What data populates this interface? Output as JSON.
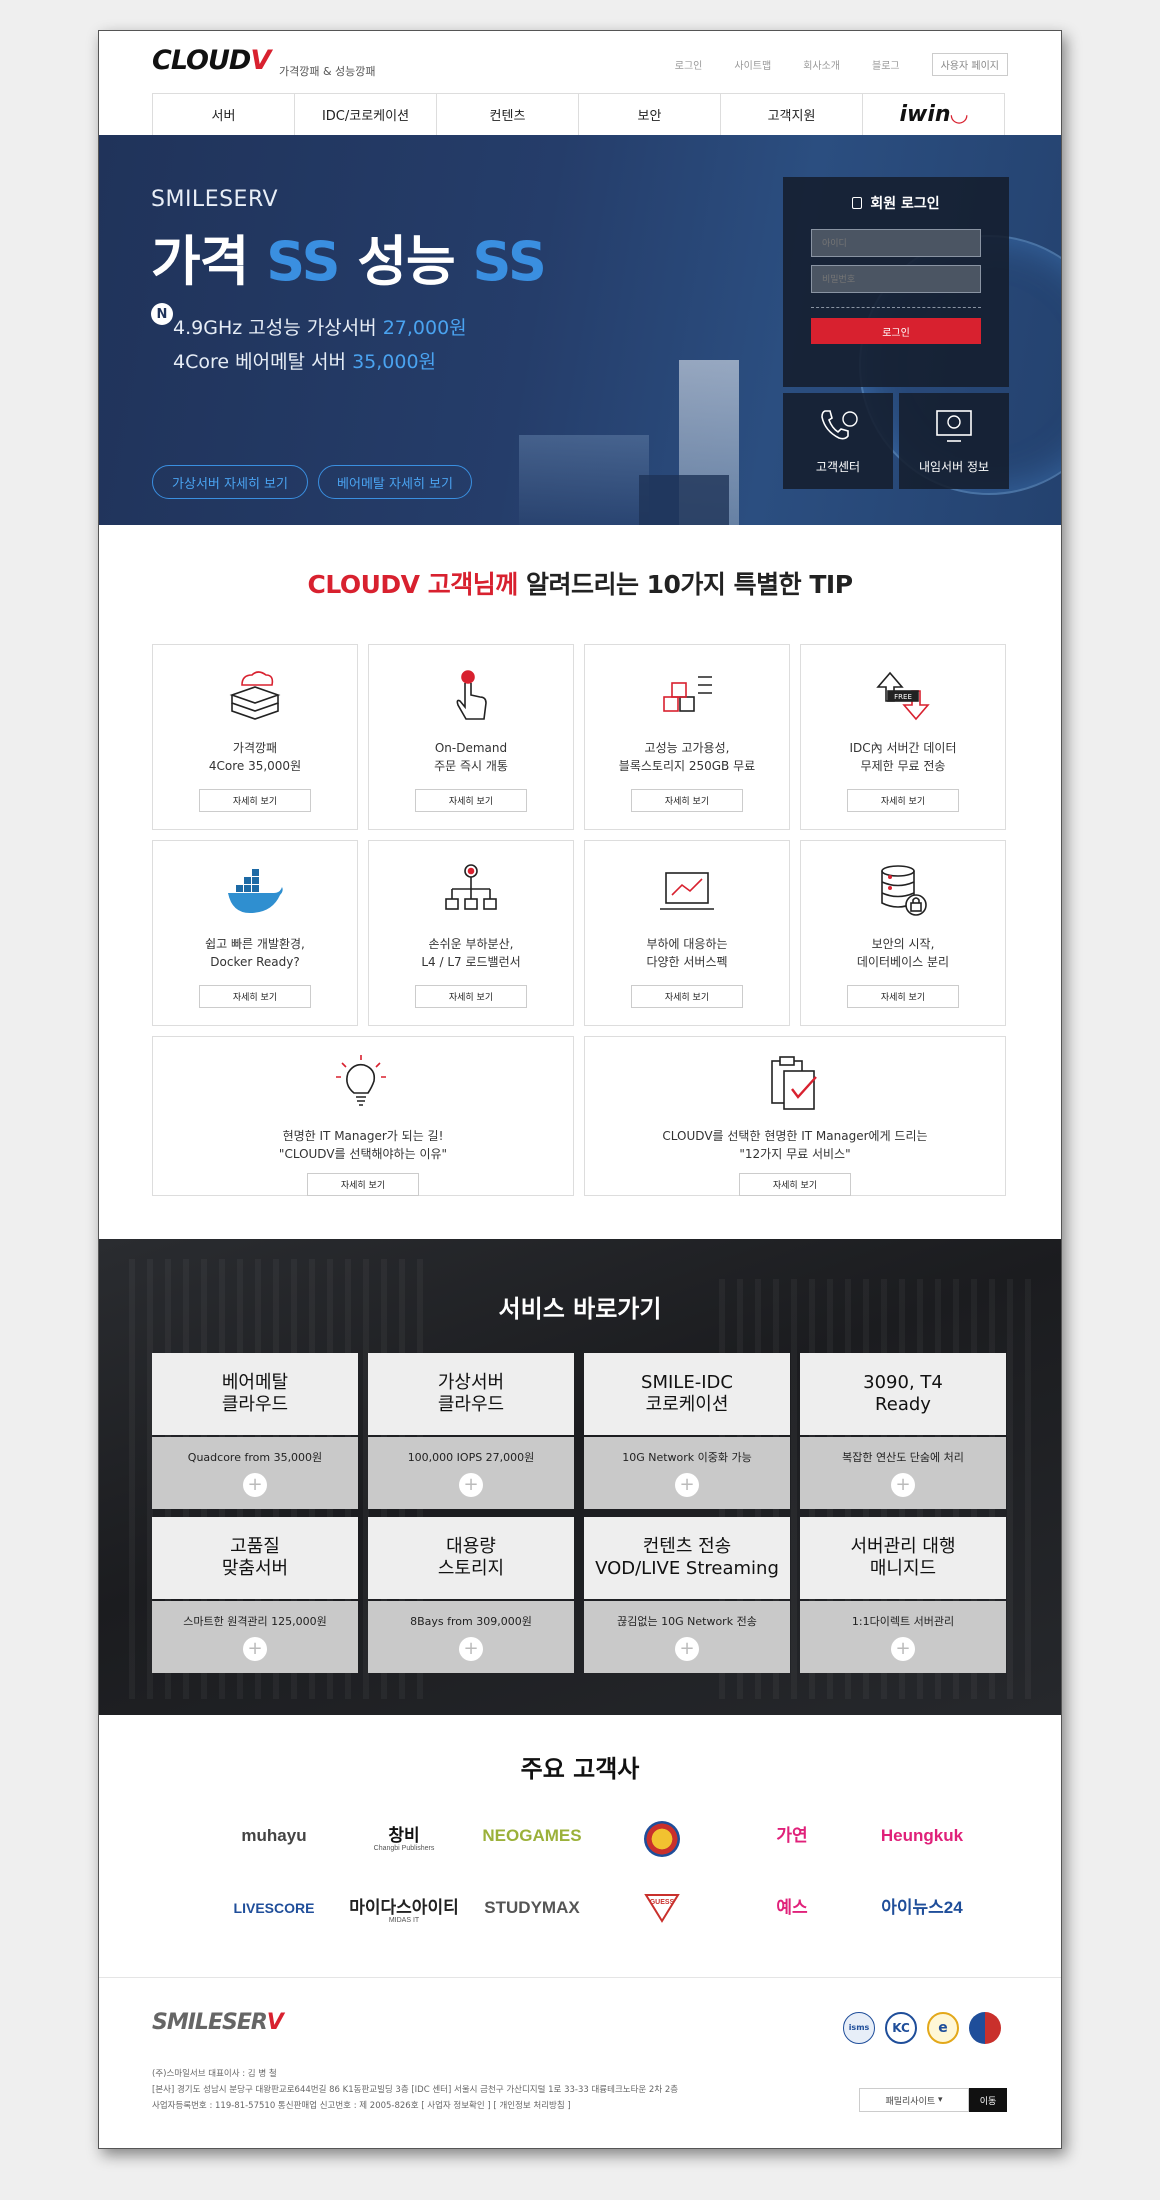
{
  "header": {
    "logo": "CLOUD",
    "logo_tail": "V",
    "tagline": "가격깡패 & 성능깡패",
    "util_links": [
      "로그인",
      "사이트맵",
      "회사소개",
      "블로그"
    ],
    "mypage": "사용자 페이지"
  },
  "nav": {
    "items": [
      "서버",
      "IDC/코로케이션",
      "컨텐츠",
      "보안",
      "고객지원"
    ],
    "partner_logo": "iwin"
  },
  "hero": {
    "brand": "SMILESERV",
    "headline_1": "가격",
    "headline_ss1": "SS",
    "headline_2": "성능",
    "headline_ss2": "SS",
    "badge": "N",
    "promo_1_text": "4.9GHz 고성능 가상서버",
    "promo_1_price": "27,000원",
    "promo_2_text": "4Core 베어메탈 서버",
    "promo_2_price": "35,000원",
    "btn_virtual": "가상서버 자세히 보기",
    "btn_baremetal": "베어메탈 자세히 보기"
  },
  "login": {
    "title": "회원 로그인",
    "id_placeholder": "아이디",
    "pw_placeholder": "비밀번호",
    "button": "로그인",
    "quick_1": "고객센터",
    "quick_2": "내임서버 정보"
  },
  "tips": {
    "title_red": "CLOUDV 고객님께",
    "title_rest": "알려드리는 10가지 특별한 TIP",
    "detail_label": "자세히 보기",
    "cards": [
      {
        "line1": "가격깡패",
        "line2": "4Core 35,000원",
        "icon": "server-cloud-icon"
      },
      {
        "line1": "On-Demand",
        "line2": "주문 즉시 개통",
        "icon": "click-hand-icon"
      },
      {
        "line1": "고성능 고가용성,",
        "line2": "블록스토리지 250GB 무료",
        "icon": "storage-blocks-icon"
      },
      {
        "line1": "IDC內 서버간 데이터",
        "line2": "무제한 무료 전송",
        "icon": "free-transfer-icon"
      },
      {
        "line1": "쉽고 빠른 개발환경,",
        "line2": "Docker Ready?",
        "icon": "docker-whale-icon"
      },
      {
        "line1": "손쉬운 부하분산,",
        "line2": "L4 / L7 로드밸런서",
        "icon": "load-balancer-icon"
      },
      {
        "line1": "부하에 대응하는",
        "line2": "다양한 서버스펙",
        "icon": "laptop-chart-icon"
      },
      {
        "line1": "보안의 시작,",
        "line2": "데이터베이스 분리",
        "icon": "database-lock-icon"
      },
      {
        "line1": "현명한 IT Manager가 되는 길!",
        "line2": "\"CLOUDV를 선택해야하는 이유\"",
        "icon": "lightbulb-icon"
      },
      {
        "line1": "CLOUDV를 선택한 현명한 IT Manager에게 드리는",
        "line2": "\"12가지 무료 서비스\"",
        "icon": "clipboard-check-icon"
      }
    ]
  },
  "services": {
    "title": "서비스 바로가기",
    "items": [
      {
        "line1": "베어메탈",
        "line2": "클라우드",
        "desc": "Quadcore from 35,000원"
      },
      {
        "line1": "가상서버",
        "line2": "클라우드",
        "desc": "100,000 IOPS 27,000원"
      },
      {
        "line1": "SMILE-IDC",
        "line2": "코로케이션",
        "desc": "10G Network 이중화 가능"
      },
      {
        "line1": "3090, T4",
        "line2": "Ready",
        "desc": "복잡한 연산도 단숨에 처리"
      },
      {
        "line1": "고품질",
        "line2": "맞춤서버",
        "desc": "스마트한 원격관리 125,000원"
      },
      {
        "line1": "대용량",
        "line2": "스토리지",
        "desc": "8Bays from 309,000원"
      },
      {
        "line1": "컨텐츠 전송",
        "line2": "VOD/LIVE Streaming",
        "desc": "끊김없는 10G Network 전송"
      },
      {
        "line1": "서버관리 대행",
        "line2": "매니지드",
        "desc": "1:1다이렉트 서버관리"
      }
    ],
    "plus": "+"
  },
  "customers": {
    "title": "주요 고객사",
    "logos": [
      {
        "name": "muhayu",
        "color": "#444444"
      },
      {
        "name": "창비",
        "sub": "Changbi Publishers",
        "color": "#111111"
      },
      {
        "name": "NEOGAMES",
        "color": "#9bb13a"
      },
      {
        "name": "",
        "color": "#c9302c"
      },
      {
        "name": "가연",
        "color": "#e0217a"
      },
      {
        "name": "Heungkuk",
        "color": "#e0217a"
      },
      {
        "name": "LIVESCORE",
        "color": "#1f4e9a"
      },
      {
        "name": "마이다스아이티",
        "sub": "MIDAS IT",
        "color": "#222222"
      },
      {
        "name": "STUDYMAX",
        "color": "#555555"
      },
      {
        "name": "GUESS",
        "color": "#c9302c"
      },
      {
        "name": "예스",
        "color": "#e0217a"
      },
      {
        "name": "아이뉴스24",
        "color": "#1f4e9a"
      }
    ]
  },
  "footer": {
    "logo": "SMILESER",
    "logo_tail": "V",
    "info_1": "(주)스마일서브 대표이사 : 김 병 철",
    "info_2": "[본사] 경기도 성남시 분당구 대왕판교로644번길 86 K1동판교빌딩 3층 [IDC 센터] 서울시 금천구 가산디지털 1로 33-33 대륭테크노타운 2차 2층",
    "info_3": "사업자등록번호 : 119-81-57510 통신판매업 신고번호 : 제 2005-826호 [ 사업자 정보확인 ] [ 개인정보 처리방침 ]",
    "family_site": "패밀리사이트",
    "go": "이동",
    "certs": [
      "isms",
      "KC",
      "e",
      "gov"
    ]
  }
}
